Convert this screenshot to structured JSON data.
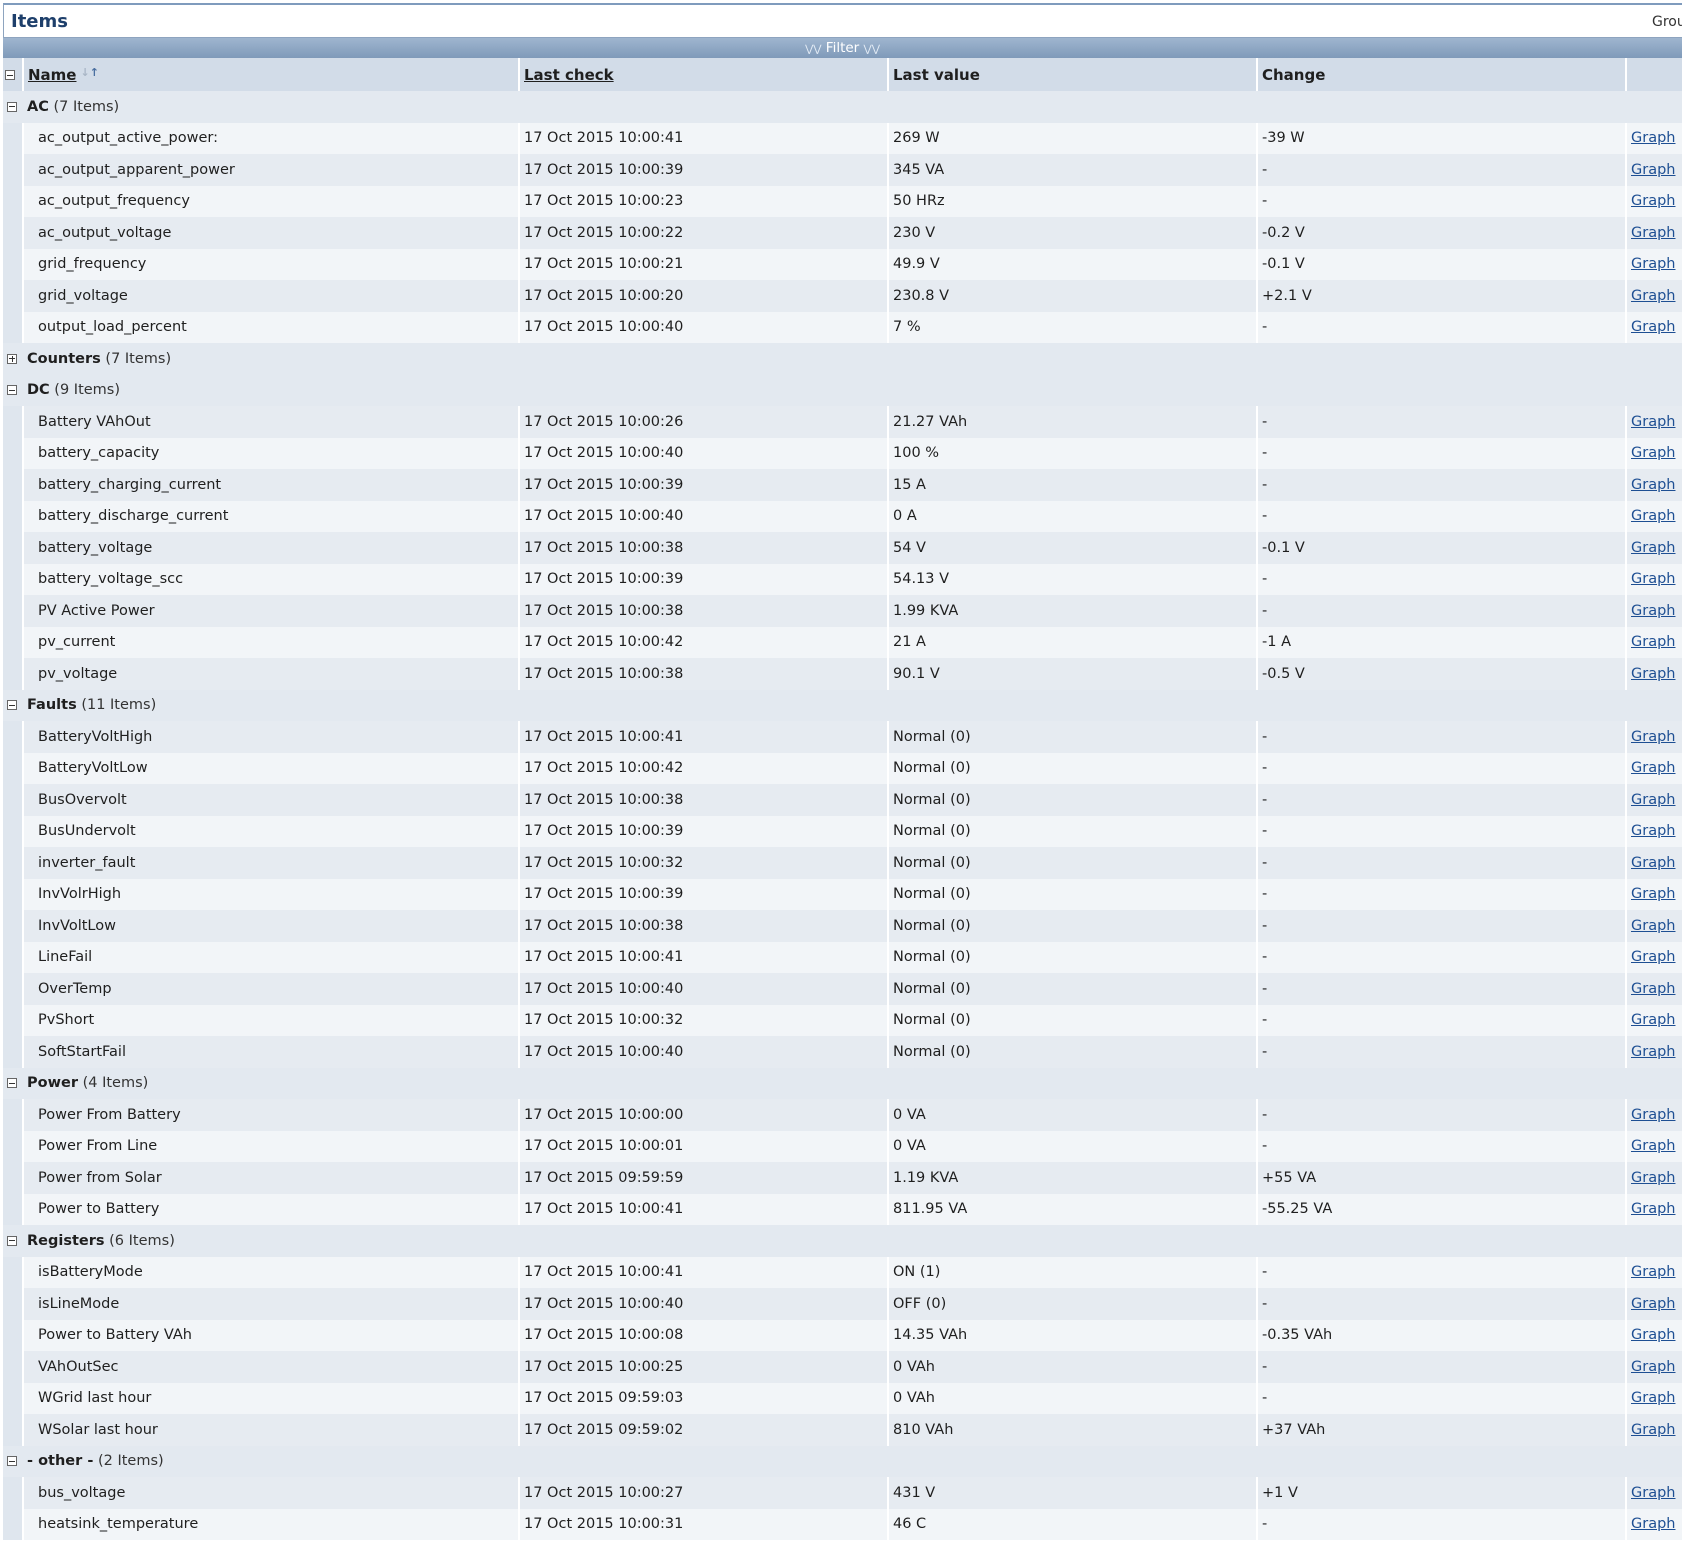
{
  "header": {
    "title": "Items",
    "group_label": "Grou"
  },
  "filter": {
    "label": "Filter"
  },
  "columns": {
    "name": "Name",
    "last_check": "Last check",
    "last_value": "Last value",
    "change": "Change"
  },
  "link_label": "Graph",
  "groups": [
    {
      "name": "AC",
      "count": "(7 Items)",
      "expanded": true,
      "items": [
        {
          "name": "ac_output_active_power:",
          "last_check": "17 Oct 2015 10:00:41",
          "last_value": "269 W",
          "change": "-39 W"
        },
        {
          "name": "ac_output_apparent_power",
          "last_check": "17 Oct 2015 10:00:39",
          "last_value": "345 VA",
          "change": "-"
        },
        {
          "name": "ac_output_frequency",
          "last_check": "17 Oct 2015 10:00:23",
          "last_value": "50 HRz",
          "change": "-"
        },
        {
          "name": "ac_output_voltage",
          "last_check": "17 Oct 2015 10:00:22",
          "last_value": "230 V",
          "change": "-0.2 V"
        },
        {
          "name": "grid_frequency",
          "last_check": "17 Oct 2015 10:00:21",
          "last_value": "49.9 V",
          "change": "-0.1 V"
        },
        {
          "name": "grid_voltage",
          "last_check": "17 Oct 2015 10:00:20",
          "last_value": "230.8 V",
          "change": "+2.1 V"
        },
        {
          "name": "output_load_percent",
          "last_check": "17 Oct 2015 10:00:40",
          "last_value": "7 %",
          "change": "-"
        }
      ]
    },
    {
      "name": "Counters",
      "count": "(7 Items)",
      "expanded": false,
      "items": []
    },
    {
      "name": "DC",
      "count": "(9 Items)",
      "expanded": true,
      "items": [
        {
          "name": "Battery VAhOut",
          "last_check": "17 Oct 2015 10:00:26",
          "last_value": "21.27 VAh",
          "change": "-"
        },
        {
          "name": "battery_capacity",
          "last_check": "17 Oct 2015 10:00:40",
          "last_value": "100 %",
          "change": "-"
        },
        {
          "name": "battery_charging_current",
          "last_check": "17 Oct 2015 10:00:39",
          "last_value": "15 A",
          "change": "-"
        },
        {
          "name": "battery_discharge_current",
          "last_check": "17 Oct 2015 10:00:40",
          "last_value": "0 A",
          "change": "-"
        },
        {
          "name": "battery_voltage",
          "last_check": "17 Oct 2015 10:00:38",
          "last_value": "54 V",
          "change": "-0.1 V"
        },
        {
          "name": "battery_voltage_scc",
          "last_check": "17 Oct 2015 10:00:39",
          "last_value": "54.13 V",
          "change": "-"
        },
        {
          "name": "PV Active Power",
          "last_check": "17 Oct 2015 10:00:38",
          "last_value": "1.99 KVA",
          "change": "-"
        },
        {
          "name": "pv_current",
          "last_check": "17 Oct 2015 10:00:42",
          "last_value": "21 A",
          "change": "-1 A"
        },
        {
          "name": "pv_voltage",
          "last_check": "17 Oct 2015 10:00:38",
          "last_value": "90.1 V",
          "change": "-0.5 V"
        }
      ]
    },
    {
      "name": "Faults",
      "count": "(11 Items)",
      "expanded": true,
      "items": [
        {
          "name": "BatteryVoltHigh",
          "last_check": "17 Oct 2015 10:00:41",
          "last_value": "Normal (0)",
          "change": "-"
        },
        {
          "name": "BatteryVoltLow",
          "last_check": "17 Oct 2015 10:00:42",
          "last_value": "Normal (0)",
          "change": "-"
        },
        {
          "name": "BusOvervolt",
          "last_check": "17 Oct 2015 10:00:38",
          "last_value": "Normal (0)",
          "change": "-"
        },
        {
          "name": "BusUndervolt",
          "last_check": "17 Oct 2015 10:00:39",
          "last_value": "Normal (0)",
          "change": "-"
        },
        {
          "name": "inverter_fault",
          "last_check": "17 Oct 2015 10:00:32",
          "last_value": "Normal (0)",
          "change": "-"
        },
        {
          "name": "InvVolrHigh",
          "last_check": "17 Oct 2015 10:00:39",
          "last_value": "Normal (0)",
          "change": "-"
        },
        {
          "name": "InvVoltLow",
          "last_check": "17 Oct 2015 10:00:38",
          "last_value": "Normal (0)",
          "change": "-"
        },
        {
          "name": "LineFail",
          "last_check": "17 Oct 2015 10:00:41",
          "last_value": "Normal (0)",
          "change": "-"
        },
        {
          "name": "OverTemp",
          "last_check": "17 Oct 2015 10:00:40",
          "last_value": "Normal (0)",
          "change": "-"
        },
        {
          "name": "PvShort",
          "last_check": "17 Oct 2015 10:00:32",
          "last_value": "Normal (0)",
          "change": "-"
        },
        {
          "name": "SoftStartFail",
          "last_check": "17 Oct 2015 10:00:40",
          "last_value": "Normal (0)",
          "change": "-"
        }
      ]
    },
    {
      "name": "Power",
      "count": "(4 Items)",
      "expanded": true,
      "items": [
        {
          "name": "Power From Battery",
          "last_check": "17 Oct 2015 10:00:00",
          "last_value": "0 VA",
          "change": "-"
        },
        {
          "name": "Power From Line",
          "last_check": "17 Oct 2015 10:00:01",
          "last_value": "0 VA",
          "change": "-"
        },
        {
          "name": "Power from Solar",
          "last_check": "17 Oct 2015 09:59:59",
          "last_value": "1.19 KVA",
          "change": "+55 VA"
        },
        {
          "name": "Power to Battery",
          "last_check": "17 Oct 2015 10:00:41",
          "last_value": "811.95 VA",
          "change": "-55.25 VA"
        }
      ]
    },
    {
      "name": "Registers",
      "count": "(6 Items)",
      "expanded": true,
      "items": [
        {
          "name": "isBatteryMode",
          "last_check": "17 Oct 2015 10:00:41",
          "last_value": "ON (1)",
          "change": "-"
        },
        {
          "name": "isLineMode",
          "last_check": "17 Oct 2015 10:00:40",
          "last_value": "OFF (0)",
          "change": "-"
        },
        {
          "name": "Power to Battery VAh",
          "last_check": "17 Oct 2015 10:00:08",
          "last_value": "14.35 VAh",
          "change": "-0.35 VAh"
        },
        {
          "name": "VAhOutSec",
          "last_check": "17 Oct 2015 10:00:25",
          "last_value": "0 VAh",
          "change": "-"
        },
        {
          "name": "WGrid last hour",
          "last_check": "17 Oct 2015 09:59:03",
          "last_value": "0 VAh",
          "change": "-"
        },
        {
          "name": "WSolar last hour",
          "last_check": "17 Oct 2015 09:59:02",
          "last_value": "810 VAh",
          "change": "+37 VAh"
        }
      ]
    },
    {
      "name": "- other -",
      "count": "(2 Items)",
      "expanded": true,
      "items": [
        {
          "name": "bus_voltage",
          "last_check": "17 Oct 2015 10:00:27",
          "last_value": "431 V",
          "change": "+1 V"
        },
        {
          "name": "heatsink_temperature",
          "last_check": "17 Oct 2015 10:00:31",
          "last_value": "46 C",
          "change": "-"
        }
      ]
    }
  ]
}
